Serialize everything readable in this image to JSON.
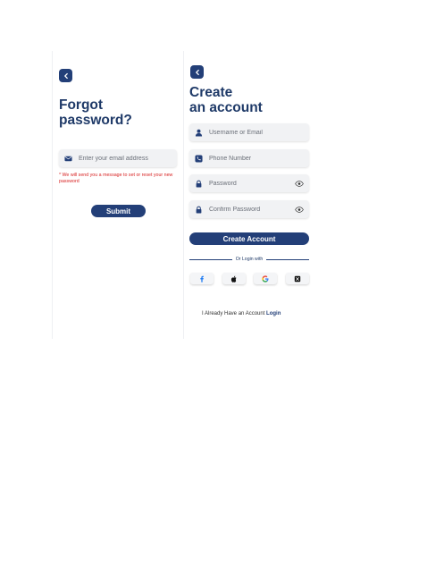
{
  "forgot": {
    "title_line1": "Forgot",
    "title_line2": "password?",
    "email_placeholder": "Enter your email address",
    "note": "* We will send you a message to set  or reset your new password",
    "submit_label": "Submit"
  },
  "signup": {
    "title_line1": "Create",
    "title_line2": "an account",
    "username_placeholder": "Username or Email",
    "phone_placeholder": "Phone Number",
    "password_placeholder": "Password",
    "confirm_placeholder": "Confirm Password",
    "create_label": "Create Account",
    "or_login_with": "Or Login with",
    "footer_text": "I Already Have an Account ",
    "footer_link": "Login"
  },
  "icons": {
    "back": "chevron-left-icon",
    "email": "envelope-icon",
    "user": "user-icon",
    "phone": "phone-icon",
    "lock": "lock-icon",
    "eye": "eye-icon",
    "facebook": "facebook-icon",
    "apple": "apple-icon",
    "google": "google-icon",
    "x": "x-icon"
  },
  "colors": {
    "primary": "#233f78",
    "field_bg": "#f1f2f4",
    "note_red": "#d82424"
  }
}
